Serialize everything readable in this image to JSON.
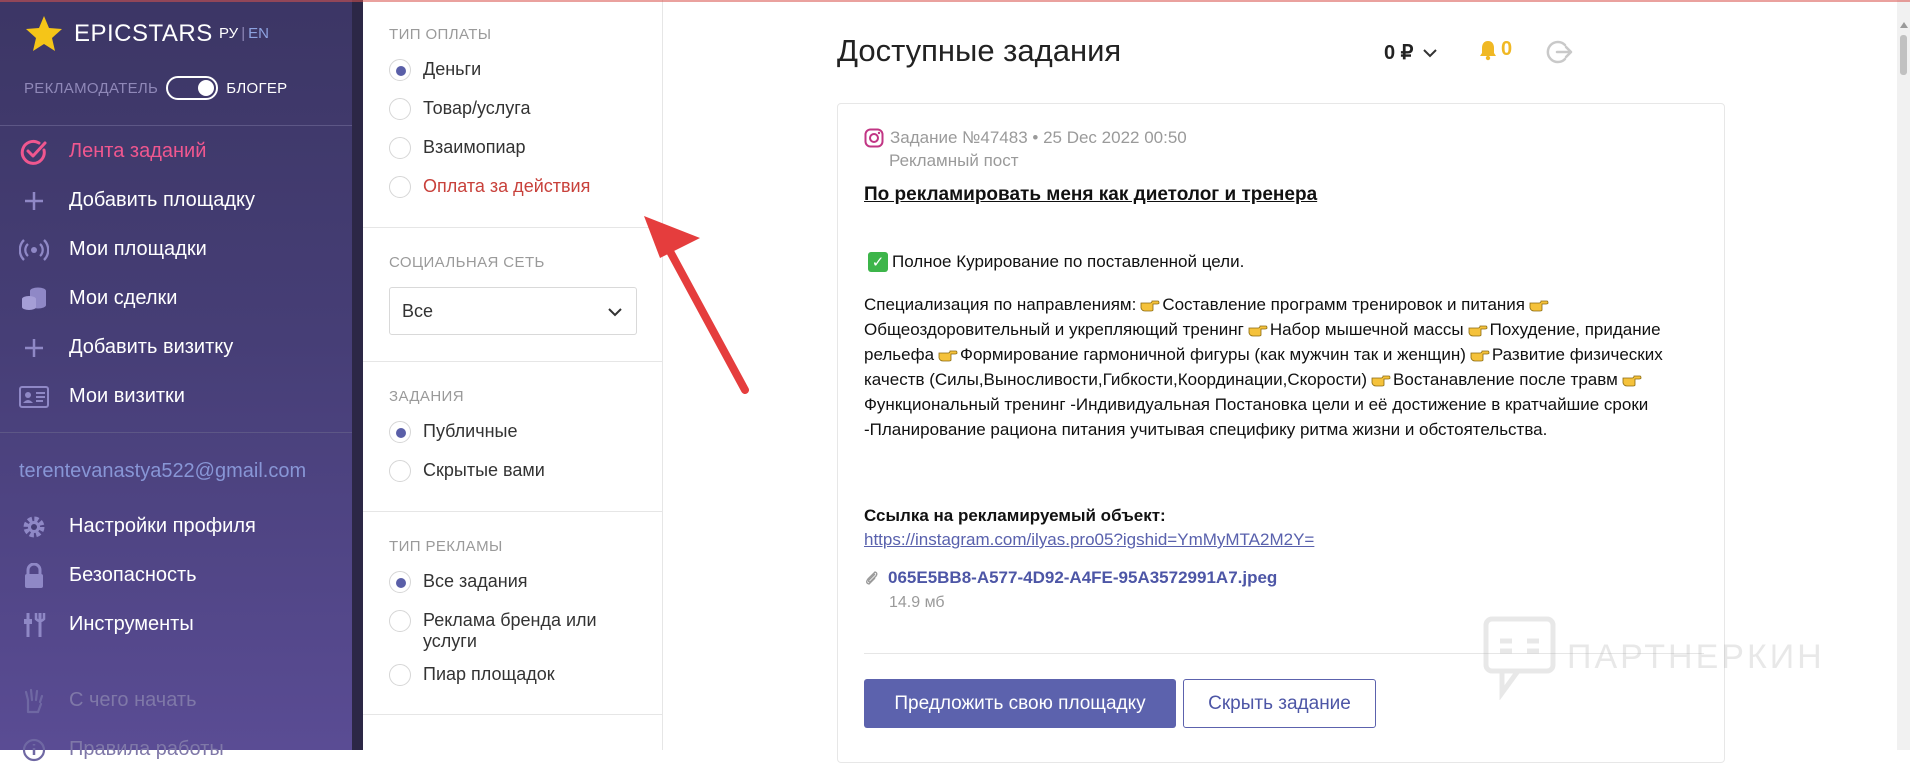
{
  "sidebar": {
    "logo": "EPICSTARS",
    "lang_ru": "РУ",
    "lang_sep": "|",
    "lang_en": "EN",
    "role_advertiser": "РЕКЛАМОДАТЕЛЬ",
    "role_blogger": "БЛОГЕР",
    "nav": [
      {
        "label": "Лента заданий",
        "icon": "check-circle-icon",
        "active": true
      },
      {
        "label": "Добавить площадку",
        "icon": "plus-icon"
      },
      {
        "label": "Мои площадки",
        "icon": "broadcast-icon"
      },
      {
        "label": "Мои сделки",
        "icon": "coins-icon"
      },
      {
        "label": "Добавить визитку",
        "icon": "plus-icon"
      },
      {
        "label": "Мои визитки",
        "icon": "id-card-icon"
      }
    ],
    "email": "terentevanastya522@gmail.com",
    "nav2": [
      {
        "label": "Настройки профиля",
        "icon": "gear-icon"
      },
      {
        "label": "Безопасность",
        "icon": "lock-icon"
      },
      {
        "label": "Инструменты",
        "icon": "tools-icon"
      },
      {
        "label": "С чего начать",
        "icon": "hand-icon"
      },
      {
        "label": "Правила работы",
        "icon": "info-icon"
      }
    ]
  },
  "filters": {
    "payment_type": {
      "title": "ТИП ОПЛАТЫ",
      "options": [
        "Деньги",
        "Товар/услуга",
        "Взаимопиар",
        "Оплата за действия"
      ]
    },
    "social": {
      "title": "СОЦИАЛЬНАЯ СЕТЬ",
      "selected": "Все"
    },
    "tasks": {
      "title": "ЗАДАНИЯ",
      "options": [
        "Публичные",
        "Скрытые вами"
      ]
    },
    "ad_type": {
      "title": "ТИП РЕКЛАМЫ",
      "options": [
        "Все задания",
        "Реклама бренда или услуги",
        "Пиар площадок"
      ]
    }
  },
  "header": {
    "title": "Доступные задания",
    "balance": "0 ₽",
    "notifications": "0"
  },
  "task": {
    "meta": "Задание №47483 • 25 Dec 2022 00:50",
    "type": "Рекламный пост",
    "title": "По рекламировать меня как диетолог и тренера",
    "bullet": "Полное Курирование по поставленной цели.",
    "desc": [
      "Специализация по направлениям:",
      "Составление программ тренировок и питания",
      "Общеоздоровительный и укрепляющий тренинг",
      "Набор мышечной массы",
      "Похудение, придание рельефа",
      "Формирование гармоничной фигуры (как мужчин так и женщин)",
      "Развитие физических качеств (Силы,Выносливости,Гибкости,Координации,Скорости)",
      "Востанавление после травм",
      "Функциональный тренинг -Индивидуальная Постановка цели и её достижение в кратчайшие сроки -Планирование рациона питания учитывая специфику ритма жизни и обстоятельства."
    ],
    "link_label": "Ссылка на рекламируемый объект:",
    "link": "https://instagram.com/ilyas.pro05?igshid=YmMyMTA2M2Y=",
    "attachment": "065E5BB8-A577-4D92-A4FE-95A3572991A7.jpeg",
    "attachment_size": "14.9 мб",
    "btn_offer": "Предложить свою площадку",
    "btn_hide": "Скрыть задание"
  },
  "watermark": "ПАРТНЕРКИН",
  "colors": {
    "accent": "#5c62ad",
    "active_nav": "#f0578f",
    "sidebar": "#463e76",
    "red": "#c8413b"
  }
}
